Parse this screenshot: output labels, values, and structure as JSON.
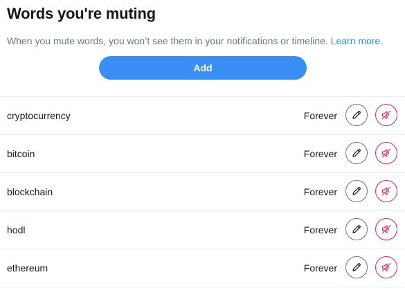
{
  "header": {
    "title": "Words you're muting",
    "description": "When you mute words, you won’t see them in your notifications or timeline.",
    "learn_more": "Learn more."
  },
  "add_button": {
    "label": "Add"
  },
  "muted_words": [
    {
      "word": "cryptocurrency",
      "duration": "Forever"
    },
    {
      "word": "bitcoin",
      "duration": "Forever"
    },
    {
      "word": "blockchain",
      "duration": "Forever"
    },
    {
      "word": "hodl",
      "duration": "Forever"
    },
    {
      "word": "ethereum",
      "duration": "Forever"
    }
  ],
  "icons": {
    "edit": "pencil-icon",
    "unmute": "muted-speaker-icon"
  },
  "colors": {
    "accent": "#3a8ff5",
    "link": "#1b95e0",
    "unmute": "#e0245e",
    "muted_text": "#657786"
  }
}
